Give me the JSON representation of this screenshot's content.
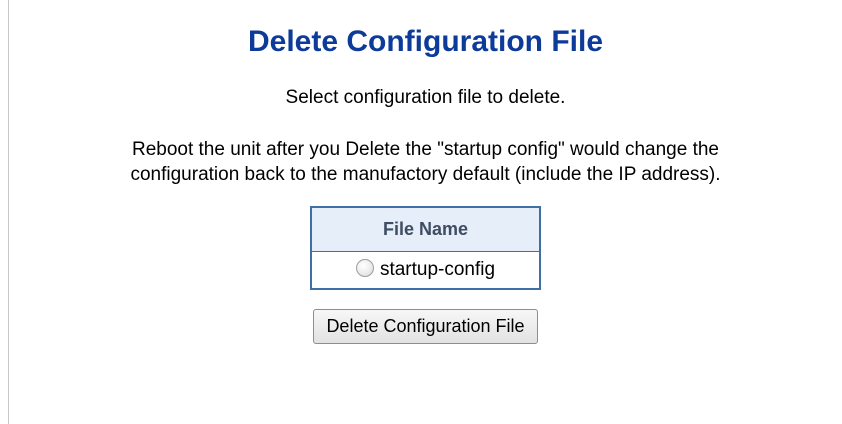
{
  "page": {
    "title": "Delete Configuration File",
    "instruction": "Select configuration file to delete.",
    "warning_line1": "Reboot the unit after you Delete the \"startup config\" would change the",
    "warning_line2": "configuration back to the manufactory default (include the IP address)."
  },
  "file_table": {
    "header": "File Name",
    "files": [
      {
        "name": "startup-config",
        "selected": false
      }
    ]
  },
  "actions": {
    "delete_label": "Delete Configuration File"
  },
  "colors": {
    "title": "#0d3b9a",
    "table_border": "#3f6fa3",
    "table_header_bg": "#e6eefa"
  }
}
